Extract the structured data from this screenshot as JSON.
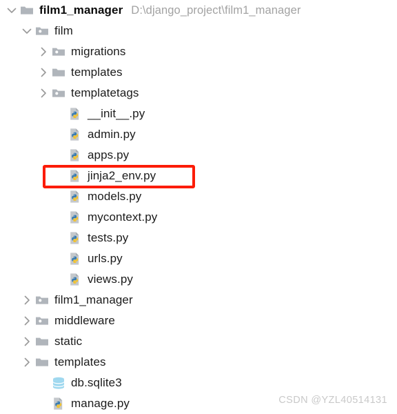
{
  "window": {
    "title": "film1_manager",
    "root_path": "D:\\django_project\\film1_manager"
  },
  "colors": {
    "folder": "#b0b5bb",
    "folder_source_root": "#b0b5bb",
    "python_doc": "#c4c8cc",
    "python_blue": "#3b7cb0",
    "python_yellow": "#f2c22e",
    "database": "#9fd8ef",
    "highlight_box": "#fc1c06",
    "text": "#1b1b1b",
    "path_text": "#a2a2a2",
    "chevron": "#9a9a9a",
    "watermark": "#c9c9c9"
  },
  "highlight": {
    "target_label": "jinja2_env.py",
    "shape": "rectangle",
    "color": "#fc1c06"
  },
  "watermark": {
    "text": "CSDN @YZL40514131"
  },
  "tree": {
    "items": [
      {
        "label": "film1_manager",
        "path": "D:\\django_project\\film1_manager",
        "icon": "folder-icon",
        "twisty": "chevron-down-icon",
        "level": 0,
        "bold": true
      },
      {
        "label": "film",
        "path": "",
        "icon": "folder-source-root-icon",
        "twisty": "chevron-down-icon",
        "level": 1,
        "bold": false
      },
      {
        "label": "migrations",
        "path": "",
        "icon": "folder-source-root-icon",
        "twisty": "chevron-right-icon",
        "level": 2,
        "bold": false
      },
      {
        "label": "templates",
        "path": "",
        "icon": "folder-icon",
        "twisty": "chevron-right-icon",
        "level": 2,
        "bold": false
      },
      {
        "label": "templatetags",
        "path": "",
        "icon": "folder-source-root-icon",
        "twisty": "chevron-right-icon",
        "level": 2,
        "bold": false
      },
      {
        "label": "__init__.py",
        "path": "",
        "icon": "python-file-icon",
        "twisty": "none",
        "level": 3,
        "bold": false
      },
      {
        "label": "admin.py",
        "path": "",
        "icon": "python-file-icon",
        "twisty": "none",
        "level": 3,
        "bold": false
      },
      {
        "label": "apps.py",
        "path": "",
        "icon": "python-file-icon",
        "twisty": "none",
        "level": 3,
        "bold": false
      },
      {
        "label": "jinja2_env.py",
        "path": "",
        "icon": "python-file-icon",
        "twisty": "none",
        "level": 3,
        "bold": false
      },
      {
        "label": "models.py",
        "path": "",
        "icon": "python-file-icon",
        "twisty": "none",
        "level": 3,
        "bold": false
      },
      {
        "label": "mycontext.py",
        "path": "",
        "icon": "python-file-icon",
        "twisty": "none",
        "level": 3,
        "bold": false
      },
      {
        "label": "tests.py",
        "path": "",
        "icon": "python-file-icon",
        "twisty": "none",
        "level": 3,
        "bold": false
      },
      {
        "label": "urls.py",
        "path": "",
        "icon": "python-file-icon",
        "twisty": "none",
        "level": 3,
        "bold": false
      },
      {
        "label": "views.py",
        "path": "",
        "icon": "python-file-icon",
        "twisty": "none",
        "level": 3,
        "bold": false
      },
      {
        "label": "film1_manager",
        "path": "",
        "icon": "folder-source-root-icon",
        "twisty": "chevron-right-icon",
        "level": 1,
        "bold": false
      },
      {
        "label": "middleware",
        "path": "",
        "icon": "folder-source-root-icon",
        "twisty": "chevron-right-icon",
        "level": 1,
        "bold": false
      },
      {
        "label": "static",
        "path": "",
        "icon": "folder-icon",
        "twisty": "chevron-right-icon",
        "level": 1,
        "bold": false
      },
      {
        "label": "templates",
        "path": "",
        "icon": "folder-icon",
        "twisty": "chevron-right-icon",
        "level": 1,
        "bold": false
      },
      {
        "label": "db.sqlite3",
        "path": "",
        "icon": "database-file-icon",
        "twisty": "none",
        "level": 2,
        "bold": false
      },
      {
        "label": "manage.py",
        "path": "",
        "icon": "python-file-icon",
        "twisty": "none",
        "level": 2,
        "bold": false
      }
    ]
  }
}
